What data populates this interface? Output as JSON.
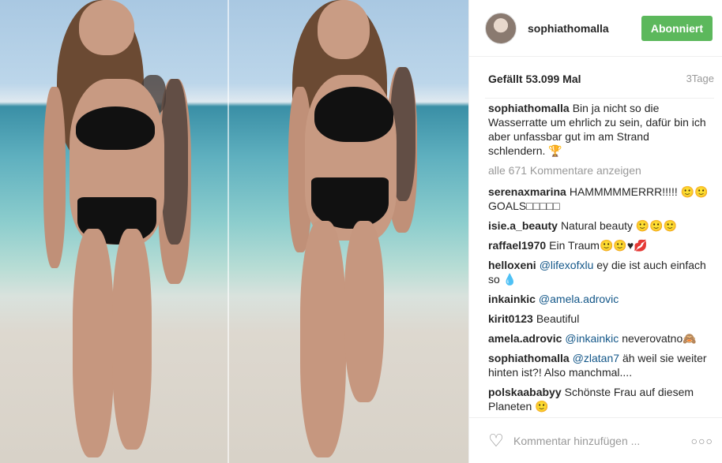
{
  "post": {
    "photo_description_icon": "beach-photo",
    "username": "sophiathomalla",
    "follow_label": "Abonniert",
    "likes": "Gefällt 53.099 Mal",
    "time": "3Tage"
  },
  "caption": {
    "user": "sophiathomalla",
    "text": "Bin ja nicht so die Wasserratte um ehrlich zu sein, dafür bin ich aber unfassbar gut im am Strand schlendern. 🏆"
  },
  "load_more": "alle 671 Kommentare anzeigen",
  "comments": [
    {
      "user": "serenaxmarina",
      "text": "HAMMMMMERRR!!!!! 🙂🙂GOALS□□□□□"
    },
    {
      "user": "isie.a_beauty",
      "text": "Natural beauty 🙂🙂🙂"
    },
    {
      "user": "raffael1970",
      "text": "Ein Traum🙂🙂♥💋"
    },
    {
      "user": "helloxeni",
      "mention": "@lifexofxlu",
      "text": "ey die ist auch einfach so 💧"
    },
    {
      "user": "inkainkic",
      "mention": "@amela.adrovic",
      "text": ""
    },
    {
      "user": "kirit0123",
      "text": "Beautiful"
    },
    {
      "user": "amela.adrovic",
      "mention": "@inkainkic",
      "text": "neverovatno🙈"
    },
    {
      "user": "sophiathomalla",
      "mention": "@zlatan7",
      "text": "äh weil sie weiter hinten ist?! Also manchmal...."
    },
    {
      "user": "polskaababyy",
      "text": "Schönste Frau auf diesem Planeten 🙂"
    }
  ],
  "footer": {
    "placeholder": "Kommentar hinzufügen ...",
    "more": "○○○",
    "heart_icon": "heart-outline-icon"
  }
}
